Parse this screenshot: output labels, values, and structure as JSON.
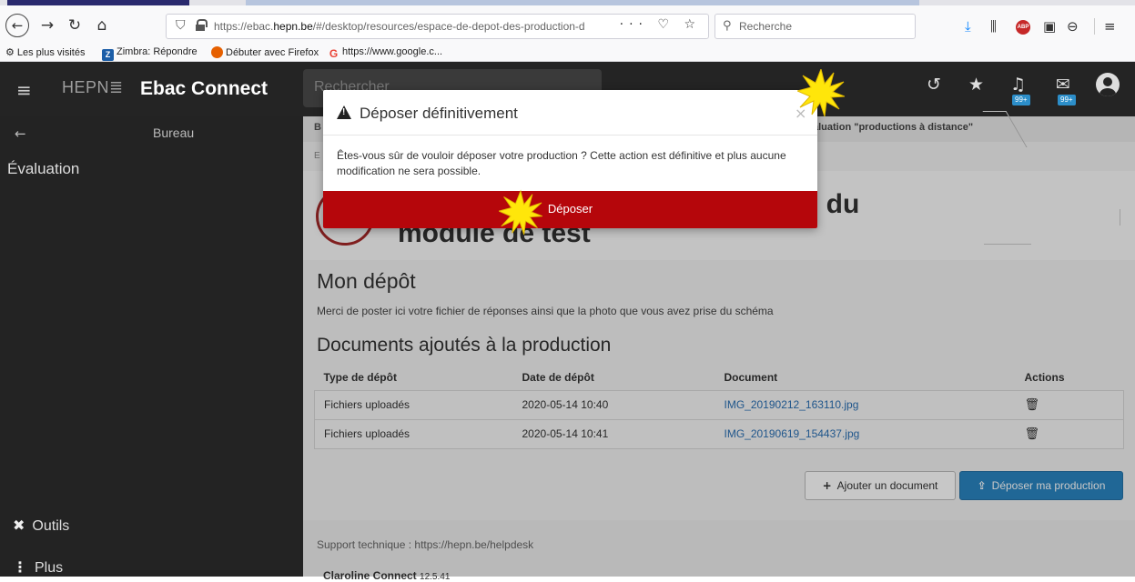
{
  "browser": {
    "url_prefix": "https://ebac.",
    "url_domain": "hepn.be",
    "url_rest": "/#/desktop/resources/espace-de-depot-des-production-d",
    "url_actions": "··· ♡ ☆",
    "search_placeholder": "Recherche",
    "bookmarks": [
      {
        "label": "Les plus visités"
      },
      {
        "label": "Zimbra: Répondre",
        "icon_letter": "Z"
      },
      {
        "label": "Débuter avec Firefox"
      },
      {
        "label": "https://www.google.c...",
        "icon_letter": "G"
      }
    ],
    "abp_label": "ABP"
  },
  "app": {
    "logo_text": "HEPN≣",
    "brand": "Ebac Connect",
    "search_placeholder": "Rechercher",
    "badges": [
      "99+",
      "99+"
    ]
  },
  "sidebar": {
    "back_label": "Bureau",
    "section": "Évaluation",
    "tools": "Outils",
    "more": "Plus"
  },
  "content": {
    "breadcrumb_first": "B",
    "breadcrumb_last": "aluation \"productions à distance\"",
    "sub_breadcrumb": "E",
    "title_line1": "n du",
    "title_line2": "module de test",
    "section_title": "Mon dépôt",
    "section_desc": "Merci de poster ici votre fichier de réponses ainsi que la photo que vous avez prise du schéma",
    "docs_title": "Documents ajoutés à la production",
    "table": {
      "headers": [
        "Type de dépôt",
        "Date de dépôt",
        "Document",
        "Actions"
      ],
      "rows": [
        {
          "type": "Fichiers uploadés",
          "date": "2020-05-14 10:40",
          "document": "IMG_20190212_163110.jpg"
        },
        {
          "type": "Fichiers uploadés",
          "date": "2020-05-14 10:41",
          "document": "IMG_20190619_154437.jpg"
        }
      ]
    },
    "add_button": "Ajouter un document",
    "submit_button": "Déposer ma production",
    "support": "Support technique : https://hepn.be/helpdesk",
    "version_name": "Claroline Connect",
    "version_number": "12.5.41"
  },
  "modal": {
    "title": "Déposer définitivement",
    "close": "×",
    "body": "Êtes-vous sûr de vouloir déposer votre production ? Cette action est définitive et plus aucune modification ne sera possible.",
    "confirm": "Déposer"
  },
  "colors": {
    "confirm_red": "#b5060b",
    "primary_blue": "#2a84c1",
    "burst_yellow": "#ffe60a"
  }
}
